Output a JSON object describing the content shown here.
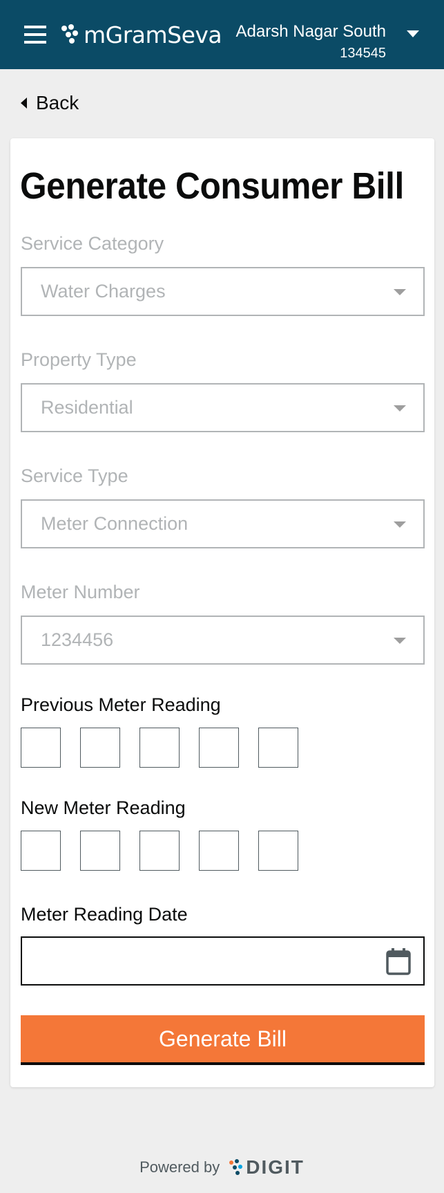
{
  "header": {
    "menu_icon": "hamburger-icon",
    "brand": "mGramSeva",
    "tenant_name": "Adarsh Nagar South",
    "tenant_code": "134545",
    "brand_color": "#0b4b66"
  },
  "back": {
    "label": "Back"
  },
  "form": {
    "title": "Generate Consumer Bill",
    "service_category": {
      "label": "Service Category",
      "value": "Water Charges"
    },
    "property_type": {
      "label": "Property Type",
      "value": "Residential"
    },
    "service_type": {
      "label": "Service Type",
      "value": "Meter Connection"
    },
    "meter_number": {
      "label": "Meter Number",
      "value": "1234456"
    },
    "previous_reading": {
      "label": "Previous Meter Reading",
      "digits": [
        "",
        "",
        "",
        "",
        ""
      ]
    },
    "new_reading": {
      "label": "New Meter Reading",
      "digits": [
        "",
        "",
        "",
        "",
        ""
      ]
    },
    "reading_date": {
      "label": "Meter Reading Date",
      "value": "",
      "icon": "calendar-icon"
    },
    "submit_label": "Generate Bill",
    "accent_color": "#f47738"
  },
  "footer": {
    "powered_by": "Powered by",
    "digit_brand": "DIGIT"
  }
}
